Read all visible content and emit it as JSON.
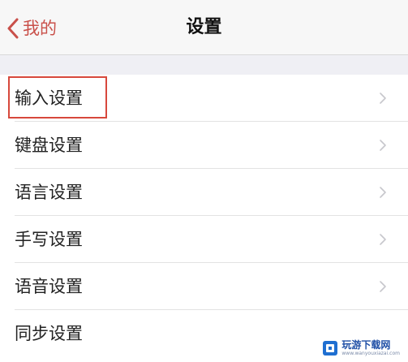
{
  "nav": {
    "back_label": "我的",
    "title": "设置"
  },
  "colors": {
    "accent": "#c9504a",
    "highlight_border": "#d7483c",
    "chevron": "#c7c7cc",
    "separator": "#e3e3e3",
    "group_gap": "#efeff4"
  },
  "settings_items": [
    {
      "label": "输入设置",
      "icon": "chevron-right-icon",
      "highlighted": true
    },
    {
      "label": "键盘设置",
      "icon": "chevron-right-icon",
      "highlighted": false
    },
    {
      "label": "语言设置",
      "icon": "chevron-right-icon",
      "highlighted": false
    },
    {
      "label": "手写设置",
      "icon": "chevron-right-icon",
      "highlighted": false
    },
    {
      "label": "语音设置",
      "icon": "chevron-right-icon",
      "highlighted": false
    },
    {
      "label": "同步设置",
      "icon": "chevron-right-icon",
      "highlighted": false
    }
  ],
  "watermark": {
    "text": "玩游下载网",
    "sub": "www.wanyouxiazai.com"
  }
}
